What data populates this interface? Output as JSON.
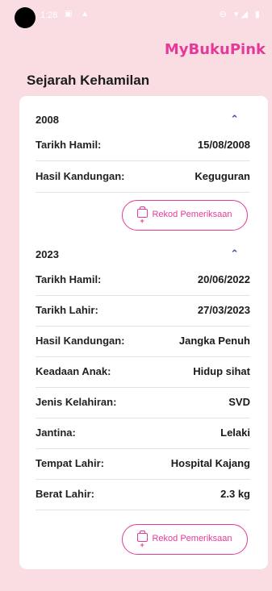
{
  "status_bar": {
    "time": "1:28",
    "left_icons": "▣ ▲",
    "right_icons": "⊖ ▾◢ ▮"
  },
  "app": {
    "brand": "MyBukuPink"
  },
  "page": {
    "title": "Sejarah Kehamilan"
  },
  "colors": {
    "accent": "#e5399a",
    "background": "#f9dde3",
    "card": "#ffffff",
    "chevron": "#3a4aa8"
  },
  "records": [
    {
      "year": "2008",
      "chevron_icon": "chevron-up-icon",
      "fields": [
        {
          "label": "Tarikh Hamil:",
          "value": "15/08/2008"
        },
        {
          "label": "Hasil Kandungan:",
          "value": "Keguguran"
        }
      ],
      "button_label": "Rekod Pemeriksaan"
    },
    {
      "year": "2023",
      "chevron_icon": "chevron-up-icon",
      "fields": [
        {
          "label": "Tarikh Hamil:",
          "value": "20/06/2022"
        },
        {
          "label": "Tarikh Lahir:",
          "value": "27/03/2023"
        },
        {
          "label": "Hasil Kandungan:",
          "value": "Jangka Penuh"
        },
        {
          "label": "Keadaan Anak:",
          "value": "Hidup sihat"
        },
        {
          "label": "Jenis Kelahiran:",
          "value": "SVD"
        },
        {
          "label": "Jantina:",
          "value": "Lelaki"
        },
        {
          "label": "Tempat Lahir:",
          "value": "Hospital Kajang"
        },
        {
          "label": "Berat Lahir:",
          "value": "2.3 kg"
        }
      ],
      "button_label": "Rekod Pemeriksaan"
    }
  ]
}
